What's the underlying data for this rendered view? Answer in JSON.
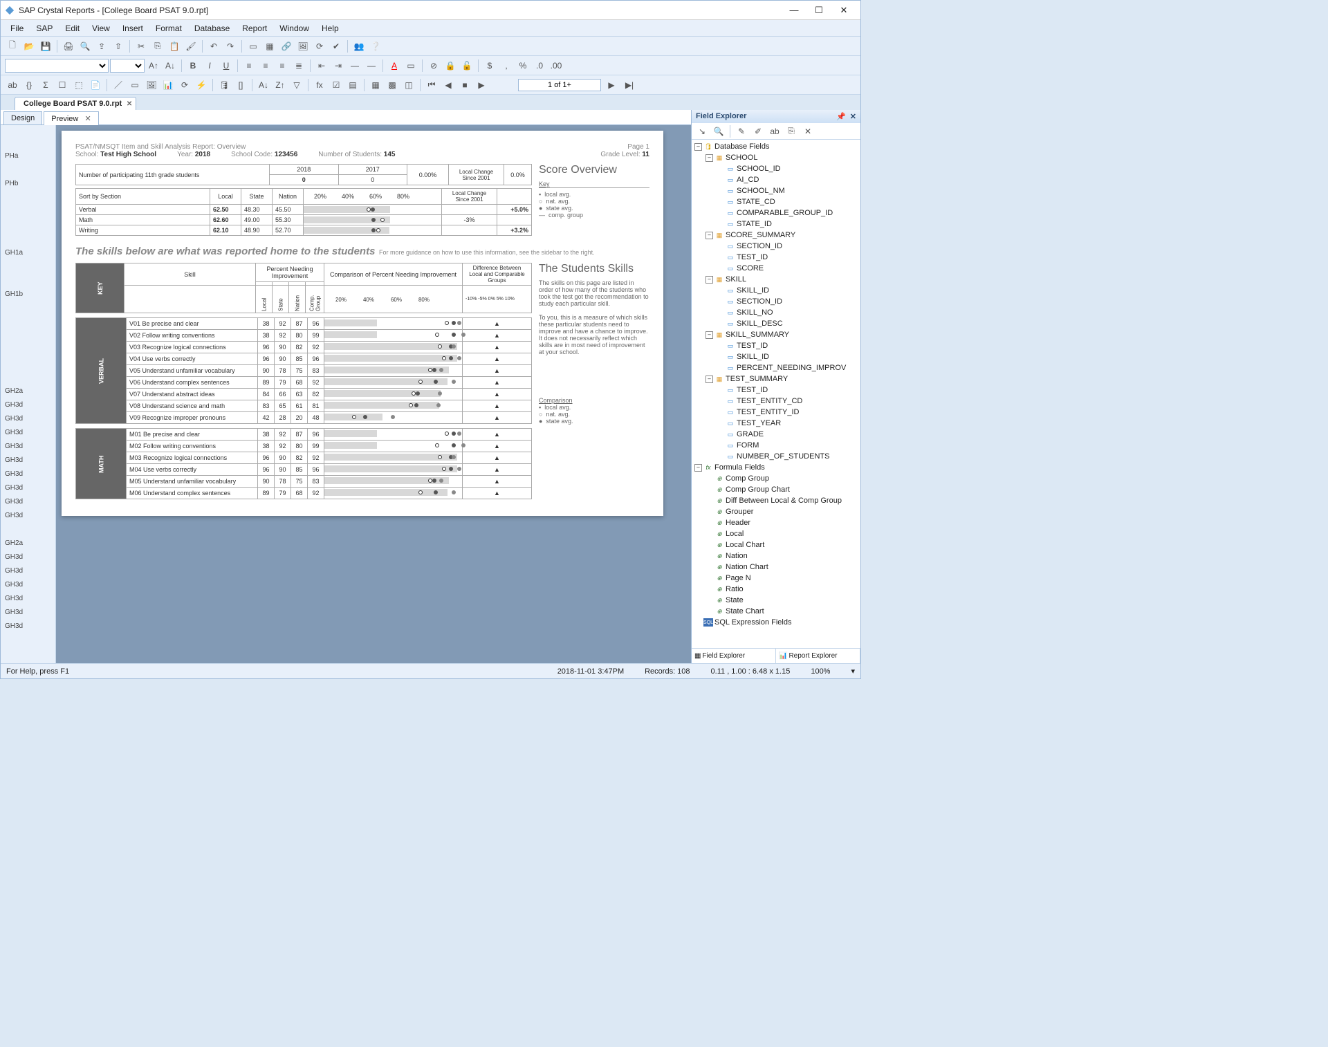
{
  "window": {
    "title": "SAP Crystal Reports - [College Board PSAT 9.0.rpt]"
  },
  "menu": [
    "File",
    "SAP",
    "Edit",
    "View",
    "Insert",
    "Format",
    "Database",
    "Report",
    "Window",
    "Help"
  ],
  "doc_tab": "College Board PSAT 9.0.rpt",
  "view_tabs": {
    "design": "Design",
    "preview": "Preview"
  },
  "pager": {
    "text": "1 of 1+"
  },
  "status": {
    "help": "For Help, press F1",
    "date": "2018-11-01  3:47PM",
    "records": "Records:  108",
    "coords": "0.11 , 1.00 : 6.48 x 1.15",
    "zoom": "100%"
  },
  "gutter": [
    "PHa",
    "",
    "PHb",
    "",
    "",
    "",
    "",
    "GH1a",
    "",
    "",
    "GH1b",
    "",
    "",
    "",
    "",
    "",
    "",
    "GH2a",
    "GH3d",
    "GH3d",
    "GH3d",
    "GH3d",
    "GH3d",
    "GH3d",
    "GH3d",
    "GH3d",
    "GH3d",
    "",
    "GH2a",
    "GH3d",
    "GH3d",
    "GH3d",
    "GH3d",
    "GH3d",
    "GH3d"
  ],
  "field_explorer": {
    "title": "Field Explorer",
    "tabs": [
      "Field Explorer",
      "Report Explorer"
    ],
    "root": "Database Fields",
    "tables": [
      {
        "name": "SCHOOL",
        "fields": [
          "SCHOOL_ID",
          "AI_CD",
          "SCHOOL_NM",
          "STATE_CD",
          "COMPARABLE_GROUP_ID",
          "STATE_ID"
        ]
      },
      {
        "name": "SCORE_SUMMARY",
        "fields": [
          "SECTION_ID",
          "TEST_ID",
          "SCORE"
        ]
      },
      {
        "name": "SKILL",
        "fields": [
          "SKILL_ID",
          "SECTION_ID",
          "SKILL_NO",
          "SKILL_DESC"
        ]
      },
      {
        "name": "SKILL_SUMMARY",
        "fields": [
          "TEST_ID",
          "SKILL_ID",
          "PERCENT_NEEDING_IMPROV"
        ]
      },
      {
        "name": "TEST_SUMMARY",
        "fields": [
          "TEST_ID",
          "TEST_ENTITY_CD",
          "TEST_ENTITY_ID",
          "TEST_YEAR",
          "GRADE",
          "FORM",
          "NUMBER_OF_STUDENTS"
        ]
      }
    ],
    "formula_root": "Formula Fields",
    "formulas": [
      "Comp Group",
      "Comp Group Chart",
      "Diff Between Local & Comp Group",
      "Grouper",
      "Header",
      "Local",
      "Local Chart",
      "Nation",
      "Nation Chart",
      "Page N",
      "Ratio",
      "State",
      "State Chart"
    ],
    "sql_root": "SQL Expression Fields"
  },
  "report": {
    "title": "PSAT/NMSQT Item and Skill Analysis Report: Overview",
    "page_label": "Page 1",
    "hdr": {
      "school_l": "School:",
      "school": "Test High School",
      "year_l": "Year:",
      "year": "2018",
      "code_l": "School Code:",
      "code": "123456",
      "stud_l": "Number of Students:",
      "stud": "145",
      "grade_l": "Grade Level:",
      "grade": "11"
    },
    "part_row": {
      "label": "Number of participating 11th grade students",
      "y1": "2018",
      "y2": "2017",
      "v1": "0",
      "v2": "0",
      "lc_pct": "0.00%",
      "lc_lbl": "Local Change Since 2001",
      "lc_v": "0.0%"
    },
    "score_overview": "Score Overview",
    "key_title": "Key",
    "key_items": [
      "local avg.",
      "nat. avg.",
      "state avg.",
      "comp. group"
    ],
    "sort_label": "Sort by Section",
    "sort_cols": [
      "Local",
      "State",
      "Nation"
    ],
    "pct_head": [
      "20%",
      "40%",
      "60%",
      "80%"
    ],
    "lc2": "Local Change Since 2001",
    "sections": [
      {
        "name": "Verbal",
        "local": "62.50",
        "state": "48.30",
        "nation": "45.50",
        "diff": "+5.0%"
      },
      {
        "name": "Math",
        "local": "62.60",
        "state": "49.00",
        "nation": "55.30",
        "diff": "-3%"
      },
      {
        "name": "Writing",
        "local": "62.10",
        "state": "48.90",
        "nation": "52.70",
        "diff": "+3.2%"
      }
    ],
    "skills_head": "The skills below are what was reported home to the students",
    "skills_sub": "For more guidance on how to use this information, see the sidebar to the right.",
    "students_skills_h": "The Students Skills",
    "students_skills_p1": "The skills on this page are listed in order of how many of the students who took the test got the recommendation to study each particular skill.",
    "students_skills_p2": "To you, this is a measure of which skills these particular students need to improve and have a chance to improve. It does not necessarily reflect which skills are in most need of improvement at your school.",
    "comparison_h": "Comparison",
    "comparison_items": [
      "local avg.",
      "nat. avg.",
      "state avg."
    ],
    "table_head": {
      "skill": "Skill",
      "pni": "Percent Needing Improvement",
      "cpni": "Comparison of Percent Needing Improvement",
      "diff": "Difference Between Local and Comparable Groups",
      "sub": [
        "Local",
        "State",
        "Nation",
        "Comp. Group"
      ],
      "pcts": [
        "20%",
        "40%",
        "60%",
        "80%"
      ],
      "diffs": [
        "-10%",
        "-5%",
        "0%",
        "5%",
        "10%"
      ]
    },
    "groups": [
      {
        "tag": "KEY",
        "rows": []
      },
      {
        "tag": "VERBAL",
        "rows": [
          {
            "c": "V01",
            "d": "Be precise and clear",
            "v": [
              38,
              92,
              87,
              96
            ]
          },
          {
            "c": "V02",
            "d": "Follow writing conventions",
            "v": [
              38,
              92,
              80,
              99
            ]
          },
          {
            "c": "V03",
            "d": "Recognize logical connections",
            "v": [
              96,
              90,
              82,
              92
            ]
          },
          {
            "c": "V04",
            "d": "Use verbs correctly",
            "v": [
              96,
              90,
              85,
              96
            ]
          },
          {
            "c": "V05",
            "d": "Understand unfamiliar vocabulary",
            "v": [
              90,
              78,
              75,
              83
            ]
          },
          {
            "c": "V06",
            "d": "Understand complex sentences",
            "v": [
              89,
              79,
              68,
              92
            ]
          },
          {
            "c": "V07",
            "d": "Understand abstract ideas",
            "v": [
              84,
              66,
              63,
              82
            ]
          },
          {
            "c": "V08",
            "d": "Understand science and math",
            "v": [
              83,
              65,
              61,
              81
            ]
          },
          {
            "c": "V09",
            "d": "Recognize improper pronouns",
            "v": [
              42,
              28,
              20,
              48
            ]
          }
        ]
      },
      {
        "tag": "MATH",
        "rows": [
          {
            "c": "M01",
            "d": "Be precise and clear",
            "v": [
              38,
              92,
              87,
              96
            ]
          },
          {
            "c": "M02",
            "d": "Follow writing conventions",
            "v": [
              38,
              92,
              80,
              99
            ]
          },
          {
            "c": "M03",
            "d": "Recognize logical connections",
            "v": [
              96,
              90,
              82,
              92
            ]
          },
          {
            "c": "M04",
            "d": "Use verbs correctly",
            "v": [
              96,
              90,
              85,
              96
            ]
          },
          {
            "c": "M05",
            "d": "Understand unfamiliar vocabulary",
            "v": [
              90,
              78,
              75,
              83
            ]
          },
          {
            "c": "M06",
            "d": "Understand complex sentences",
            "v": [
              89,
              79,
              68,
              92
            ]
          }
        ]
      }
    ]
  },
  "chart_data": {
    "score_overview": {
      "type": "bar",
      "categories": [
        "Verbal",
        "Math",
        "Writing"
      ],
      "series": [
        {
          "name": "Local",
          "values": [
            62.5,
            62.6,
            62.1
          ]
        },
        {
          "name": "State",
          "values": [
            48.3,
            49.0,
            48.9
          ]
        },
        {
          "name": "Nation",
          "values": [
            45.5,
            55.3,
            52.7
          ]
        }
      ],
      "xlim": [
        0,
        100
      ],
      "xticks": [
        20,
        40,
        60,
        80
      ],
      "local_change_since_2001": [
        "+5.0%",
        "-3%",
        "+3.2%"
      ]
    },
    "skill_percent_needing_improvement": {
      "type": "bar",
      "xlim": [
        0,
        100
      ],
      "xticks": [
        20,
        40,
        60,
        80
      ],
      "series_names": [
        "Local",
        "State",
        "Nation",
        "Comp. Group"
      ],
      "verbal": {
        "skills": [
          "V01",
          "V02",
          "V03",
          "V04",
          "V05",
          "V06",
          "V07",
          "V08",
          "V09"
        ],
        "Local": [
          38,
          38,
          96,
          96,
          90,
          89,
          84,
          83,
          42
        ],
        "State": [
          92,
          92,
          90,
          90,
          78,
          79,
          66,
          65,
          28
        ],
        "Nation": [
          87,
          80,
          82,
          85,
          75,
          68,
          63,
          61,
          20
        ],
        "CompGroup": [
          96,
          99,
          92,
          96,
          83,
          92,
          82,
          81,
          48
        ]
      },
      "math": {
        "skills": [
          "M01",
          "M02",
          "M03",
          "M04",
          "M05",
          "M06"
        ],
        "Local": [
          38,
          38,
          96,
          96,
          90,
          89
        ],
        "State": [
          92,
          92,
          90,
          90,
          78,
          79
        ],
        "Nation": [
          87,
          80,
          82,
          85,
          75,
          68
        ],
        "CompGroup": [
          96,
          99,
          92,
          96,
          83,
          92
        ]
      }
    }
  }
}
